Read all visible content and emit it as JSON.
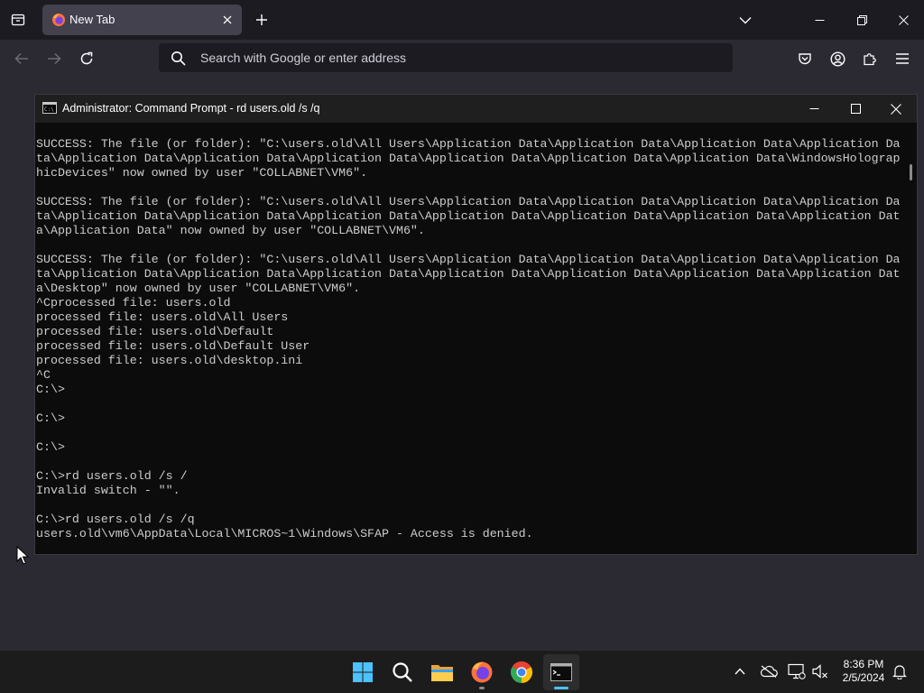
{
  "browser": {
    "tab": {
      "title": "New Tab"
    },
    "urlbar": {
      "placeholder": "Search with Google or enter address"
    }
  },
  "cmd": {
    "title": "Administrator: Command Prompt - rd  users.old /s /q",
    "console_lines": [
      "SUCCESS: The file (or folder): \"C:\\users.old\\All Users\\Application Data\\Application Data\\Application Data\\Application Da",
      "ta\\Application Data\\Application Data\\Application Data\\Application Data\\Application Data\\Application Data\\WindowsHolograp",
      "hicDevices\" now owned by user \"COLLABNET\\VM6\".",
      "",
      "SUCCESS: The file (or folder): \"C:\\users.old\\All Users\\Application Data\\Application Data\\Application Data\\Application Da",
      "ta\\Application Data\\Application Data\\Application Data\\Application Data\\Application Data\\Application Data\\Application Dat",
      "a\\Application Data\" now owned by user \"COLLABNET\\VM6\".",
      "",
      "SUCCESS: The file (or folder): \"C:\\users.old\\All Users\\Application Data\\Application Data\\Application Data\\Application Da",
      "ta\\Application Data\\Application Data\\Application Data\\Application Data\\Application Data\\Application Data\\Application Dat",
      "a\\Desktop\" now owned by user \"COLLABNET\\VM6\".",
      "^Cprocessed file: users.old",
      "processed file: users.old\\All Users",
      "processed file: users.old\\Default",
      "processed file: users.old\\Default User",
      "processed file: users.old\\desktop.ini",
      "^C",
      "C:\\>",
      "",
      "C:\\>",
      "",
      "C:\\>",
      "",
      "C:\\>rd users.old /s /",
      "Invalid switch - \"\".",
      "",
      "C:\\>rd users.old /s /q",
      "users.old\\vm6\\AppData\\Local\\MICROS~1\\Windows\\SFAP - Access is denied."
    ]
  },
  "taskbar": {
    "apps": [
      "start",
      "search",
      "file-explorer",
      "firefox",
      "chrome",
      "terminal"
    ],
    "clock": {
      "time": "8:36 PM",
      "date": "2/5/2024"
    }
  },
  "colors": {
    "console_bg": "#0c0c0c",
    "console_text": "#cccccc",
    "browser_chrome": "#1c1b22",
    "taskbar_accent": "#4cc2ff"
  }
}
